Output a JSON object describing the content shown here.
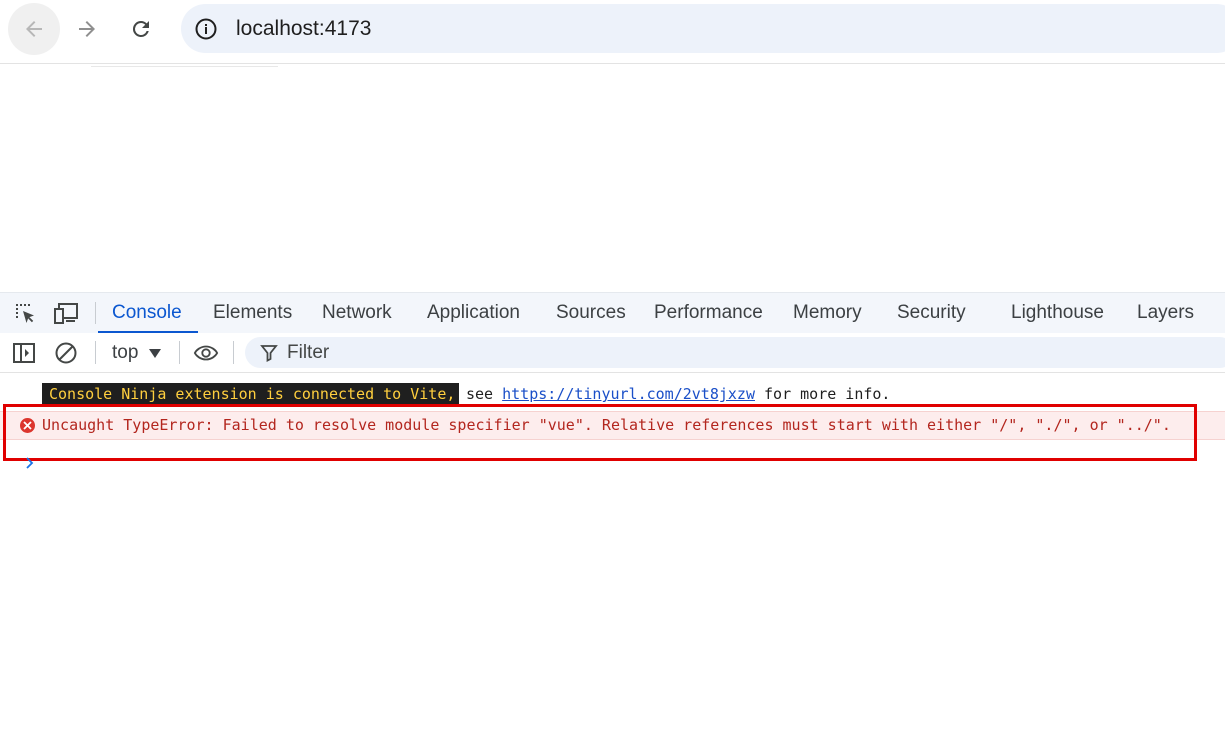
{
  "browser": {
    "url": "localhost:4173",
    "icons": {
      "back": "arrow-left-icon",
      "forward": "arrow-right-icon",
      "reload": "reload-icon",
      "site_info": "info-icon"
    }
  },
  "devtools": {
    "tabs": [
      {
        "label": "Console",
        "active": true
      },
      {
        "label": "Elements",
        "active": false
      },
      {
        "label": "Network",
        "active": false
      },
      {
        "label": "Application",
        "active": false
      },
      {
        "label": "Sources",
        "active": false
      },
      {
        "label": "Performance",
        "active": false
      },
      {
        "label": "Memory",
        "active": false
      },
      {
        "label": "Security",
        "active": false
      },
      {
        "label": "Lighthouse",
        "active": false
      },
      {
        "label": "Layers",
        "active": false
      }
    ],
    "toolbar": {
      "context": "top",
      "filter_placeholder": "Filter"
    },
    "accent_color": "#0b57d0"
  },
  "console": {
    "info": {
      "badge": "Console Ninja extension is connected to Vite,",
      "see": "see",
      "link": "https://tinyurl.com/2vt8jxzw",
      "suffix": "for more info."
    },
    "error": {
      "text": "Uncaught TypeError: Failed to resolve module specifier \"vue\". Relative references must start with either \"/\", \"./\", or \"../\".",
      "color": "#b3261e",
      "background": "#fdeded"
    },
    "highlight_color": "#e00000"
  }
}
